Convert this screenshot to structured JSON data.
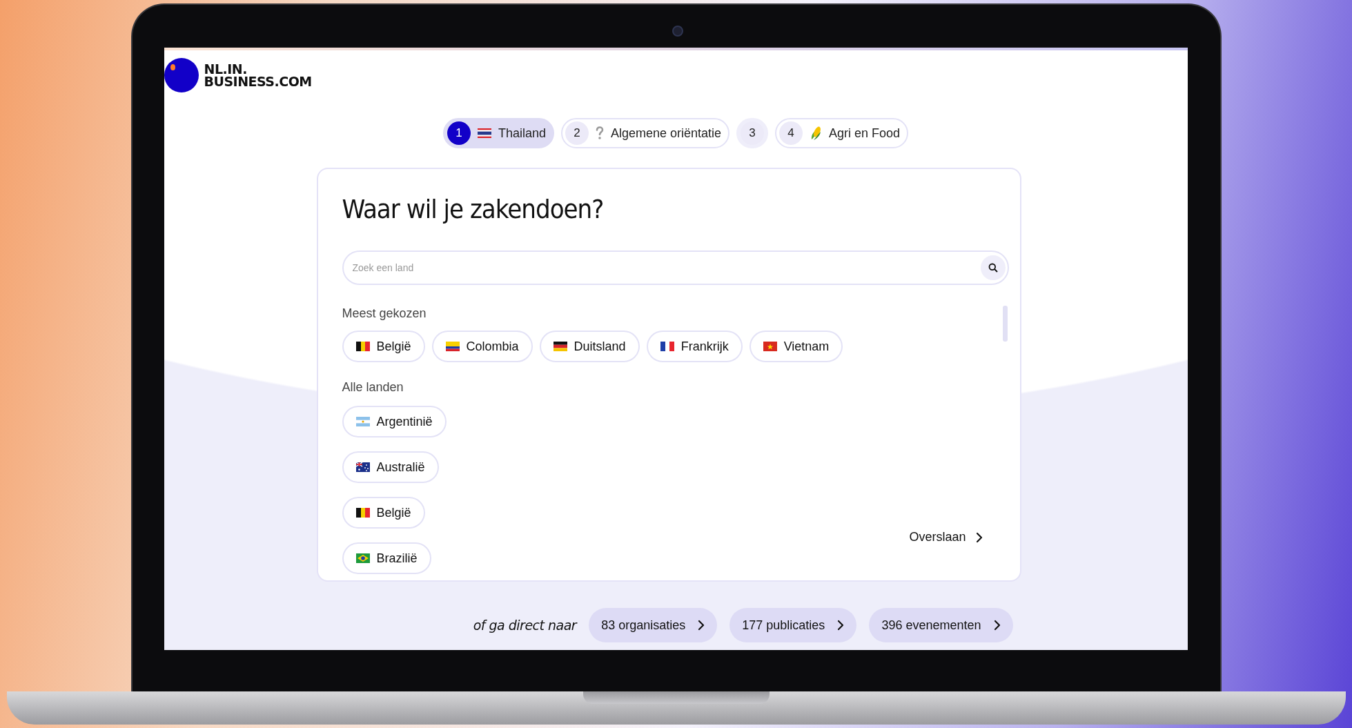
{
  "logo": {
    "line_1": "NL.IN.",
    "line_2": "BUSINESS.COM"
  },
  "steps": [
    {
      "number": "1",
      "label": "Thailand",
      "kind": "flag-th",
      "selected": true
    },
    {
      "number": "2",
      "label": "Algemene oriëntatie",
      "kind": "question",
      "selected": false
    },
    {
      "number": "3",
      "kind": "none",
      "selected": false
    },
    {
      "number": "4",
      "label": "Agri en Food",
      "kind": "corn",
      "selected": false
    }
  ],
  "card": {
    "title": "Waar wil je zakendoen?",
    "search": {
      "placeholder": "Zoek een land"
    },
    "popular": {
      "heading": "Meest gekozen",
      "countries": [
        {
          "name": "België",
          "kind": "be"
        },
        {
          "name": "Colombia",
          "kind": "co"
        },
        {
          "name": "Duitsland",
          "kind": "de"
        },
        {
          "name": "Frankrijk",
          "kind": "fr"
        },
        {
          "name": "Vietnam",
          "kind": "vn"
        }
      ]
    },
    "all": {
      "heading": "Alle landen",
      "countries": [
        {
          "name": "Argentinië",
          "kind": "ar"
        },
        {
          "name": "Australië",
          "kind": "au"
        },
        {
          "name": "België",
          "kind": "be"
        },
        {
          "name": "Brazilië",
          "kind": "br"
        }
      ]
    },
    "skip": "Overslaan"
  },
  "footer": {
    "lead": "of ga direct naar",
    "links": [
      "83 organisaties",
      "177 publicaties",
      "396 evenementen"
    ]
  }
}
